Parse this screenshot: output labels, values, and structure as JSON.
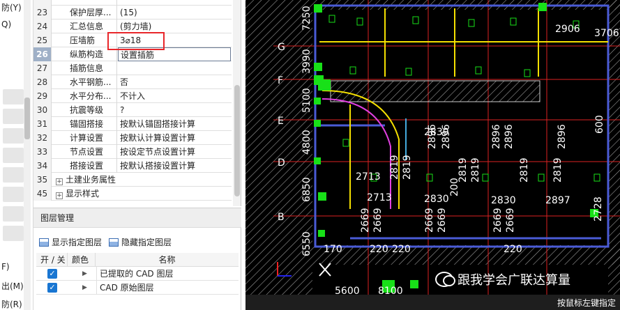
{
  "left_strip": {
    "labels": [
      "防(Y)",
      "Q)",
      "F)",
      "出(M)",
      "防(R)"
    ]
  },
  "property_rows": [
    {
      "num": "23",
      "name": "保护层厚...",
      "value": "(15)"
    },
    {
      "num": "24",
      "name": "汇总信息",
      "value": "(剪力墙)"
    },
    {
      "num": "25",
      "name": "压墙筋",
      "value": "3⌀18"
    },
    {
      "num": "26",
      "name": "纵筋构造",
      "value": "设置插筋"
    },
    {
      "num": "27",
      "name": "插筋信息",
      "value": ""
    },
    {
      "num": "28",
      "name": "水平钢筋...",
      "value": "否"
    },
    {
      "num": "29",
      "name": "水平分布...",
      "value": "不计入"
    },
    {
      "num": "30",
      "name": "抗震等级",
      "value": "?"
    },
    {
      "num": "31",
      "name": "锚固搭接",
      "value": "按默认锚固搭接计算"
    },
    {
      "num": "32",
      "name": "计算设置",
      "value": "按默认计算设置计算"
    },
    {
      "num": "33",
      "name": "节点设置",
      "value": "按设定节点设置计算"
    },
    {
      "num": "34",
      "name": "搭接设置",
      "value": "按默认搭接设置计算"
    }
  ],
  "group_rows": [
    {
      "num": "35",
      "name": "土建业务属性"
    },
    {
      "num": "45",
      "name": "显示样式"
    }
  ],
  "selected_row": "26",
  "layer_panel": {
    "title": "图层管理",
    "show_label": "显示指定图层",
    "hide_label": "隐藏指定图层",
    "col_toggle": "开 / 关",
    "col_color": "颜色",
    "col_name": "名称",
    "layers": [
      {
        "name": "已提取的 CAD 图层",
        "checked": true
      },
      {
        "name": "CAD 原始图层",
        "checked": true
      }
    ]
  },
  "canvas": {
    "axis_labels": [
      "G",
      "F",
      "E",
      "D",
      "B"
    ],
    "left_dims": [
      "7250",
      "3990",
      "5100",
      "4800",
      "6850",
      "6550"
    ],
    "top_dims": [
      "2906",
      "3706"
    ],
    "dims_h": [
      "2713",
      "2713",
      "2830",
      "2830",
      "2830",
      "2897",
      "170",
      "220",
      "220",
      "220",
      "5600",
      "8100"
    ],
    "dims_v": [
      "2819",
      "2819",
      "2819",
      "2819",
      "2896",
      "2896",
      "2896",
      "2896",
      "2896",
      "600",
      "2819",
      "2669",
      "2669",
      "2669",
      "2669",
      "2669",
      "2669",
      "2819",
      "200",
      "2728"
    ],
    "status": "按鼠标左键指定"
  },
  "watermark": "跟我学会广联达算量",
  "colors": {
    "highlight": "#e8262a",
    "selected_row": "#9fb0c7",
    "checkbox": "#1976d2",
    "canvas_bg": "#000000"
  }
}
